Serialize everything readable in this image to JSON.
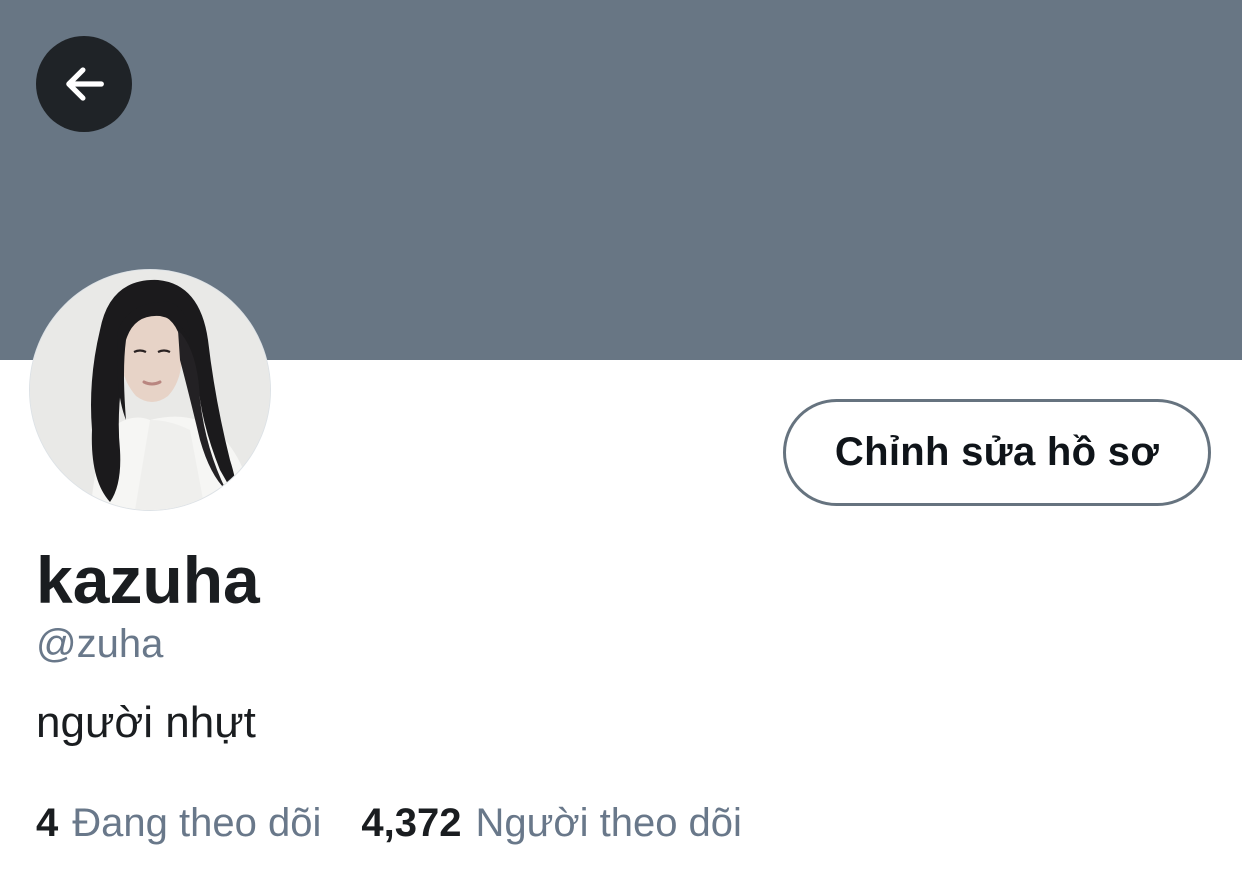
{
  "header": {
    "back_icon": "arrow-left-icon",
    "banner_color": "#687684"
  },
  "profile": {
    "avatar_alt": "profile photo",
    "edit_button_label": "Chỉnh sửa hồ sơ",
    "display_name": "kazuha",
    "handle": "@zuha",
    "bio": "người nhựt"
  },
  "stats": {
    "following": {
      "count": "4",
      "label": "Đang theo dõi"
    },
    "followers": {
      "count": "4,372",
      "label": "Người theo dõi"
    }
  }
}
